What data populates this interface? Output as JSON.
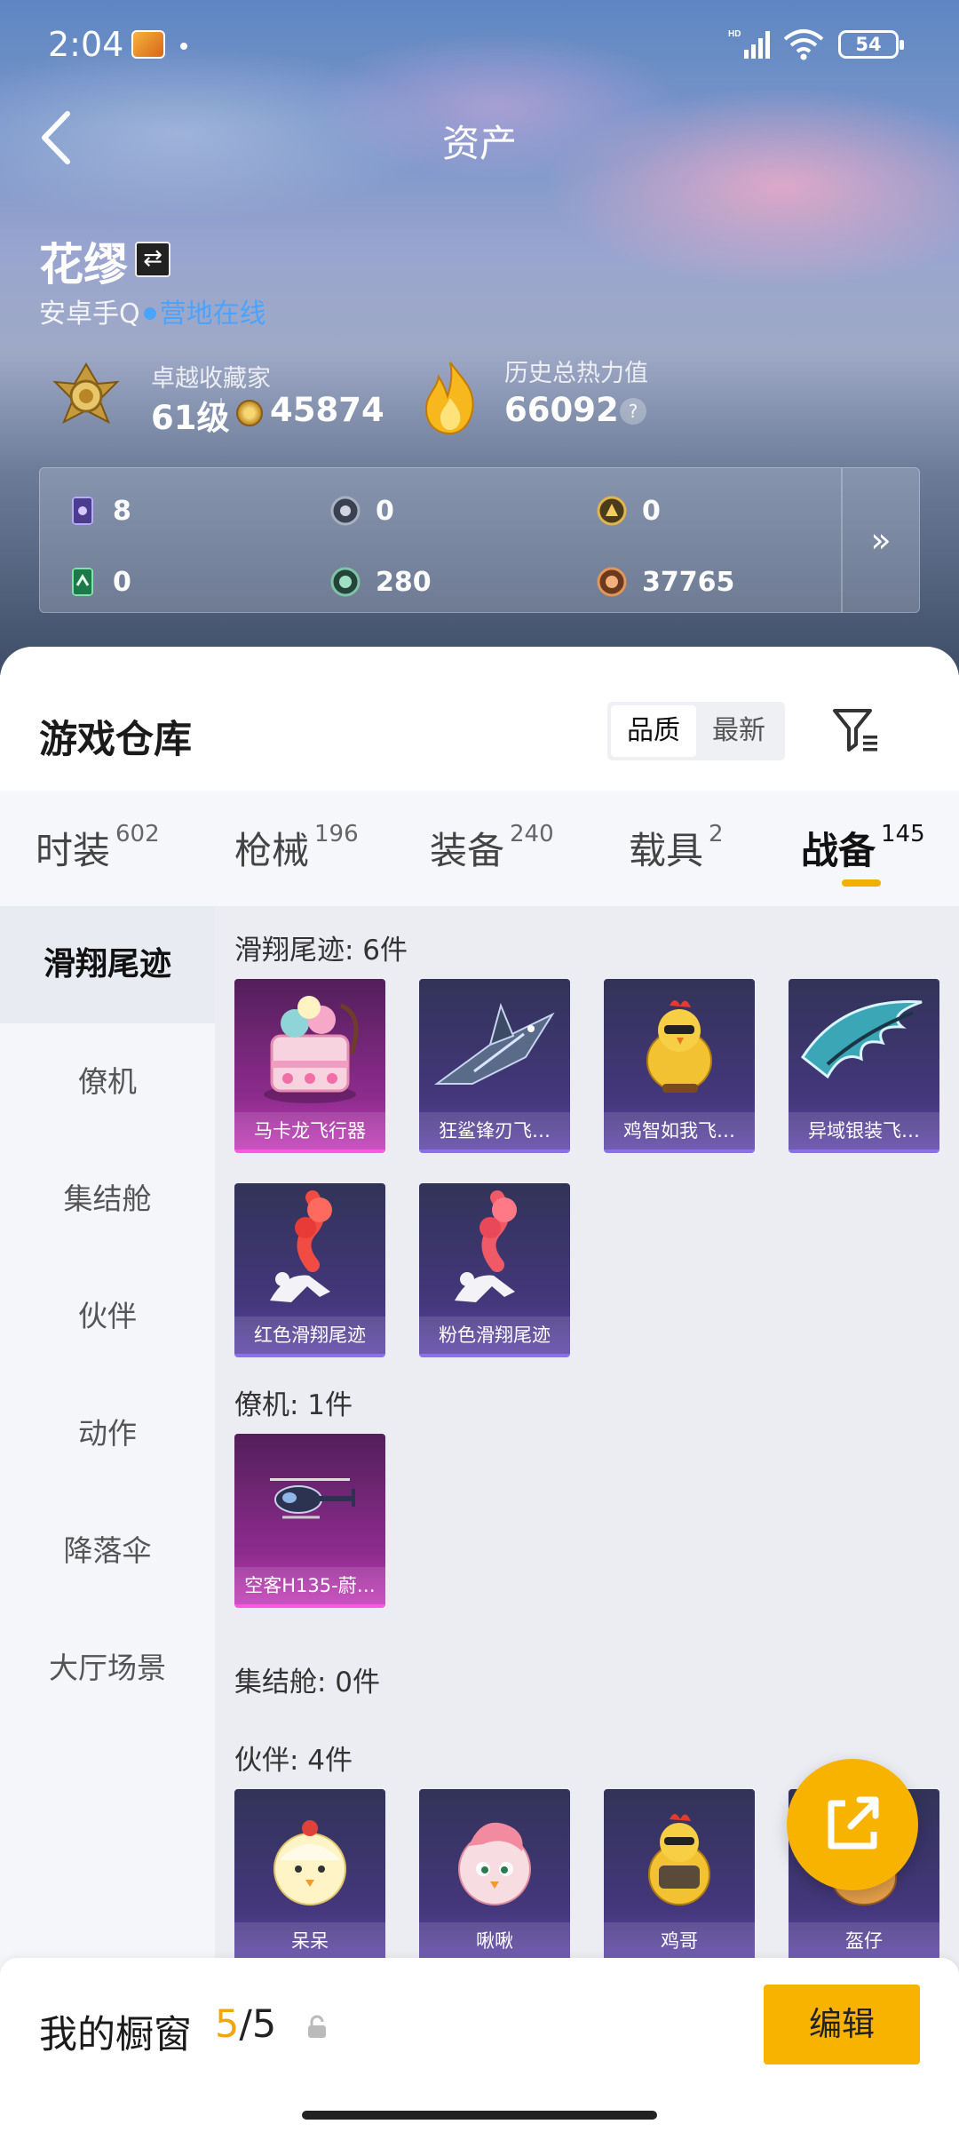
{
  "status_bar": {
    "time": "2:04",
    "battery": "54"
  },
  "header": {
    "title": "资产"
  },
  "profile": {
    "name": "花缪",
    "platform": "安卓手Q",
    "online_status": "营地在线",
    "rank_label": "卓越收藏家",
    "level": "61级",
    "coins": "45874",
    "heat_label": "历史总热力值",
    "heat_value": "66092",
    "help": "?"
  },
  "resources": [
    "8",
    "0",
    "0",
    "0",
    "280",
    "37765"
  ],
  "resources_more": "»",
  "warehouse": {
    "title": "游戏仓库",
    "sort_options": [
      "品质",
      "最新"
    ],
    "sort_active": "品质"
  },
  "tabs": [
    {
      "label": "时装",
      "count": "602"
    },
    {
      "label": "枪械",
      "count": "196"
    },
    {
      "label": "装备",
      "count": "240"
    },
    {
      "label": "载具",
      "count": "2"
    },
    {
      "label": "战备",
      "count": "145"
    }
  ],
  "active_tab": "战备",
  "sidebar": [
    "滑翔尾迹",
    "僚机",
    "集结舱",
    "伙伴",
    "动作",
    "降落伞",
    "大厅场景"
  ],
  "sections": [
    {
      "title": "滑翔尾迹: 6件",
      "items": [
        "马卡龙飞行器",
        "狂鲨锋刃飞…",
        "鸡智如我飞…",
        "异域银装飞…",
        "红色滑翔尾迹",
        "粉色滑翔尾迹"
      ]
    },
    {
      "title": "僚机: 1件",
      "items": [
        "空客H135-蔚…"
      ]
    },
    {
      "title": "集结舱: 0件",
      "items": []
    },
    {
      "title": "伙伴: 4件",
      "items": [
        "呆呆",
        "啾啾",
        "鸡哥",
        "盔仔"
      ]
    }
  ],
  "bottom": {
    "label": "我的橱窗",
    "current": "5",
    "total": "/5",
    "edit": "编辑"
  },
  "colors": {
    "accent": "#f8b300",
    "online": "#4aa4ff",
    "epic_card": "#44377c",
    "legend_card": "#8e2c8e"
  }
}
